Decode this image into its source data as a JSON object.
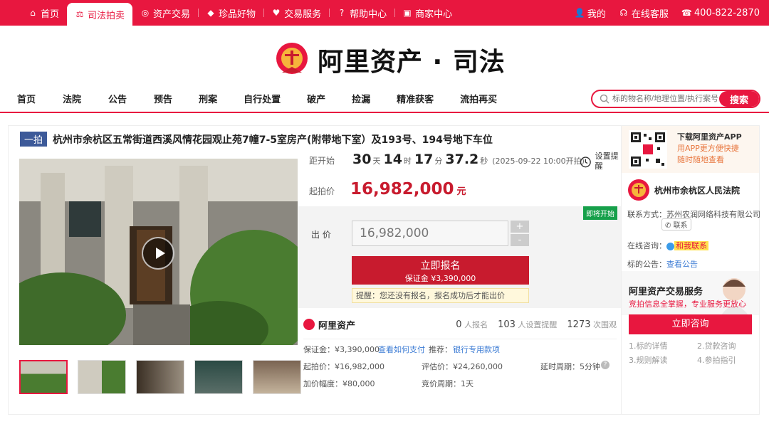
{
  "topbar": {
    "nav": [
      {
        "icon": "home-icon",
        "glyph": "⌂",
        "label": "首页"
      },
      {
        "icon": "gavel-icon",
        "glyph": "⚖",
        "label": "司法拍卖",
        "active": true
      },
      {
        "icon": "asset-icon",
        "glyph": "◎",
        "label": "资产交易"
      },
      {
        "icon": "gem-icon",
        "glyph": "◆",
        "label": "珍品好物"
      },
      {
        "icon": "heart-icon",
        "glyph": "♥",
        "label": "交易服务"
      },
      {
        "icon": "help-icon",
        "glyph": "?",
        "label": "帮助中心"
      },
      {
        "icon": "shop-icon",
        "glyph": "▣",
        "label": "商家中心"
      }
    ],
    "my": "我的",
    "service": "在线客服",
    "phone": "400-822-2870"
  },
  "brand": {
    "name": "阿里资产 · 司法"
  },
  "catnav": [
    "首页",
    "法院",
    "公告",
    "预告",
    "刑案",
    "自行处置",
    "破产",
    "捡漏",
    "精准获客",
    "流拍再买"
  ],
  "search": {
    "placeholder": "标的物名称/地理位置/执行案号",
    "button": "搜索"
  },
  "item": {
    "badge": "一拍",
    "title": "杭州市余杭区五常街道西溪风情花园观止苑7幢7-5室房产(附带地下室）及193号、194号地下车位"
  },
  "countdown": {
    "label": "距开始",
    "days": "30",
    "days_unit": "天",
    "hours": "14",
    "hours_unit": "时",
    "minutes": "17",
    "minutes_unit": "分",
    "seconds": "37.2",
    "seconds_unit": "秒",
    "note": "(2025-09-22 10:00开拍)"
  },
  "remind": {
    "label": "设置提醒"
  },
  "start_price": {
    "label": "起拍价",
    "value": "16,982,000",
    "unit": "元"
  },
  "bid": {
    "tag": "即将开始",
    "label": "出 价",
    "value": "16,982,000",
    "plus": "+",
    "minus": "-",
    "register_main": "立即报名",
    "register_sub": "保证金 ¥3,390,000",
    "tip": "提醒：您还没有报名，报名成功后才能出价"
  },
  "platform": {
    "name": "阿里资产",
    "signed": "0",
    "signed_lbl": "人报名",
    "reminders": "103",
    "reminders_lbl": "人设置提醒",
    "views": "1273",
    "views_lbl": "次围观"
  },
  "details": {
    "deposit": "保证金：¥3,390,000",
    "pay_link": "查看如何支付",
    "recommend_lbl": "推荐：",
    "recommend_link": "银行专用款项",
    "start": "起拍价：¥16,982,000",
    "appraisal": "评估价：¥24,260,000",
    "delay": "延时周期：5分钟",
    "increment": "加价幅度：¥80,000",
    "period": "竞价周期：1天"
  },
  "side": {
    "app_title": "下载阿里资产APP",
    "app_sub1": "用APP更方便快捷",
    "app_sub2": "随时随地查看",
    "court": "杭州市余杭区人民法院",
    "contact_lbl": "联系方式：",
    "contact_val": "苏州农润网络科技有限公司",
    "contact_chip": "联系",
    "online_lbl": "在线咨询：",
    "online_val": "和我联系",
    "notice_lbl": "标的公告：",
    "notice_link": "查看公告",
    "service_title": "阿里资产交易服务",
    "service_sub": "竞拍信息全掌握，专业服务更放心",
    "consult_btn": "立即咨询",
    "steps": [
      "1.标的详情",
      "2.贷款咨询",
      "3.规则解读",
      "4.参拍指引"
    ]
  },
  "colors": {
    "brand_red": "#e8173f",
    "price_red": "#c81b2e",
    "badge_blue": "#3d5a99",
    "tag_green": "#16a04a"
  }
}
